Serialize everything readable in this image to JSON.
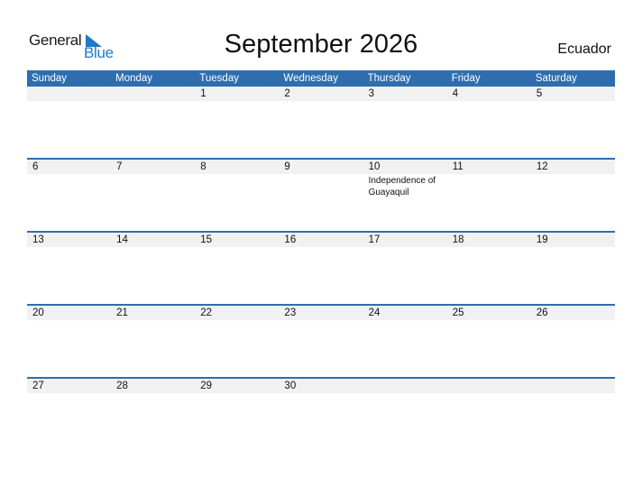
{
  "logo": {
    "word1": "General",
    "word2": "Blue"
  },
  "title": "September 2026",
  "country": "Ecuador",
  "colors": {
    "header_bg": "#2e6eaf",
    "accent": "#1f7ac8",
    "daybar_bg": "#f1f1f1"
  },
  "weekdays": [
    "Sunday",
    "Monday",
    "Tuesday",
    "Wednesday",
    "Thursday",
    "Friday",
    "Saturday"
  ],
  "weeks": [
    {
      "days": [
        "",
        "",
        "1",
        "2",
        "3",
        "4",
        "5"
      ],
      "events": [
        "",
        "",
        "",
        "",
        "",
        "",
        ""
      ]
    },
    {
      "days": [
        "6",
        "7",
        "8",
        "9",
        "10",
        "11",
        "12"
      ],
      "events": [
        "",
        "",
        "",
        "",
        "Independence of Guayaquil",
        "",
        ""
      ]
    },
    {
      "days": [
        "13",
        "14",
        "15",
        "16",
        "17",
        "18",
        "19"
      ],
      "events": [
        "",
        "",
        "",
        "",
        "",
        "",
        ""
      ]
    },
    {
      "days": [
        "20",
        "21",
        "22",
        "23",
        "24",
        "25",
        "26"
      ],
      "events": [
        "",
        "",
        "",
        "",
        "",
        "",
        ""
      ]
    },
    {
      "days": [
        "27",
        "28",
        "29",
        "30",
        "",
        "",
        ""
      ],
      "events": [
        "",
        "",
        "",
        "",
        "",
        "",
        ""
      ]
    }
  ]
}
